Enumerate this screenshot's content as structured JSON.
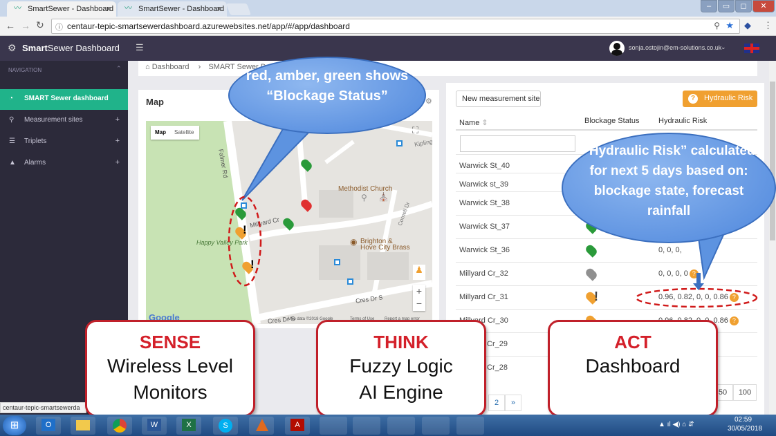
{
  "browser": {
    "tabs": [
      {
        "title": "SmartSewer - Dashboard"
      },
      {
        "title": "SmartSewer - Dashboard"
      }
    ],
    "url": "centaur-tepic-smartsewerdashboard.azurewebsites.net/app/#/app/dashboard",
    "status_url": "centaur-tepic-smartsewerda"
  },
  "app": {
    "brand_bold": "Smart",
    "brand_rest": "Sewer Dashboard",
    "user_email": "sonja.ostojin@em-solutions.co.uk",
    "nav_label": "NAVIGATION",
    "nav": [
      {
        "label": "SMART Sewer dashboard",
        "icon": "dashboard-icon",
        "active": true
      },
      {
        "label": "Measurement sites",
        "icon": "map-marker-icon"
      },
      {
        "label": "Triplets",
        "icon": "list-icon"
      },
      {
        "label": "Alarms",
        "icon": "warning-icon"
      }
    ],
    "breadcrumb": {
      "home": "Dashboard",
      "current": "SMART Sewer D"
    }
  },
  "map": {
    "title": "Map",
    "type_buttons": [
      "Map",
      "Satellite"
    ],
    "labels": [
      "Falmer Rd",
      "Kipling",
      "Methodist Church",
      "Millyard Cr",
      "Happy Valley Park",
      "Brighton &",
      "Hove City Brass",
      "Cornell Dr",
      "Cres Dr S",
      "Cres Dr S"
    ],
    "attribution": "Map data ©2018 Google",
    "terms": "Terms of Use",
    "report": "Report a map error",
    "google_logo": "Google"
  },
  "table": {
    "new_site_button": "New measurement site",
    "hydraulic_button": "Hydraulic Risk",
    "headers": {
      "name": "Name",
      "blockage": "Blockage Status",
      "risk": "Hydraulic Risk"
    },
    "rows": [
      {
        "name": "Warwick St_40",
        "status": "",
        "risk": ""
      },
      {
        "name": "Warwick st_39",
        "status": "",
        "risk": ""
      },
      {
        "name": "Warwick St_38",
        "status": "",
        "risk": ""
      },
      {
        "name": "Warwick St_37",
        "status": "green",
        "risk": ""
      },
      {
        "name": "Warwick St_36",
        "status": "green",
        "risk": "0, 0, 0,"
      },
      {
        "name": "Millyard Cr_32",
        "status": "grey",
        "risk": "0, 0, 0, 0"
      },
      {
        "name": "Millyard Cr_31",
        "status": "amber",
        "risk": "0.96, 0.82, 0, 0, 0.86"
      },
      {
        "name": "Millyard Cr_30",
        "status": "amber",
        "risk": "0.96, 0.82, 0, 0, 0.86"
      },
      {
        "name": "Cr_29",
        "status": "",
        "risk": ""
      },
      {
        "name": "Cr_28",
        "status": "",
        "risk": ""
      }
    ],
    "pagination": [
      "2",
      "»"
    ],
    "page_sizes": [
      "50",
      "100"
    ]
  },
  "annotations": {
    "bubble_blockage": "red, amber, green shows “Blockage Status”",
    "bubble_risk": "“Hydraulic Risk” calculated for next 5 days based on: blockage state, forecast rainfall",
    "sense": {
      "head": "SENSE",
      "line1": "Wireless Level",
      "line2": "Monitors"
    },
    "think": {
      "head": "THINK",
      "line1": "Fuzzy Logic",
      "line2": "AI Engine"
    },
    "act": {
      "head": "ACT",
      "line1": "Dashboard"
    }
  },
  "taskbar": {
    "time": "02:59",
    "date": "30/05/2018"
  },
  "colors": {
    "accent": "#20b38a",
    "sidebar": "#2c2a3a",
    "topbar": "#3a364d",
    "amber": "#f0a030",
    "red_callout": "#c0202a",
    "bubble": "#4d86dc"
  }
}
